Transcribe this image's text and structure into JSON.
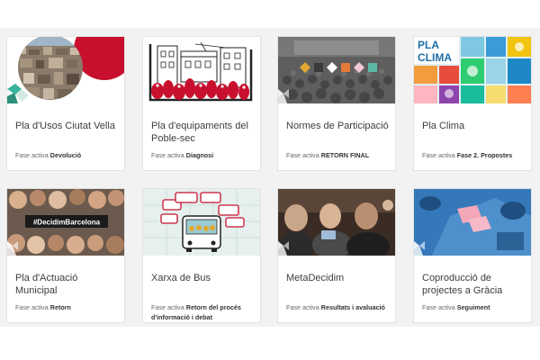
{
  "cards": [
    {
      "title": "Pla d'Usos Ciutat Vella",
      "phase_label": "Fase activa",
      "phase_value": "Devolució",
      "image": "aerial-city-circle"
    },
    {
      "title": "Pla d'equipaments del Poble-sec",
      "phase_label": "Fase activa",
      "phase_value": "Diagnosi",
      "image": "building-illustration"
    },
    {
      "title": "Normes de Participació",
      "phase_label": "Fase activa",
      "phase_value": "RETORN FINAL",
      "image": "auditorium-photo"
    },
    {
      "title": "Pla Clima",
      "phase_label": "Fase activa",
      "phase_value": "Fase 2. Propostes",
      "image": "pla-clima-poster",
      "image_text_1": "PLA",
      "image_text_2": "CLIMA"
    },
    {
      "title": "Pla d'Actuació Municipal",
      "phase_label": "Fase activa",
      "phase_value": "Retorn",
      "image": "people-collage",
      "image_text_1": "#DecidimBarcelona"
    },
    {
      "title": "Xarxa de Bus",
      "phase_label": "Fase activa",
      "phase_value": "Retorn del procés d'informació i debat",
      "image": "bus-illustration"
    },
    {
      "title": "MetaDecidim",
      "phase_label": "Fase activa",
      "phase_value": "Resultats i avaluació",
      "image": "meeting-photo"
    },
    {
      "title": "Coproducció de projectes a Gràcia",
      "phase_label": "Fase activa",
      "phase_value": "Seguiment",
      "image": "workshop-photo"
    }
  ],
  "colors": {
    "accent": "#c8102e",
    "teal": "#3bb39b",
    "blue": "#2f7ec4"
  }
}
